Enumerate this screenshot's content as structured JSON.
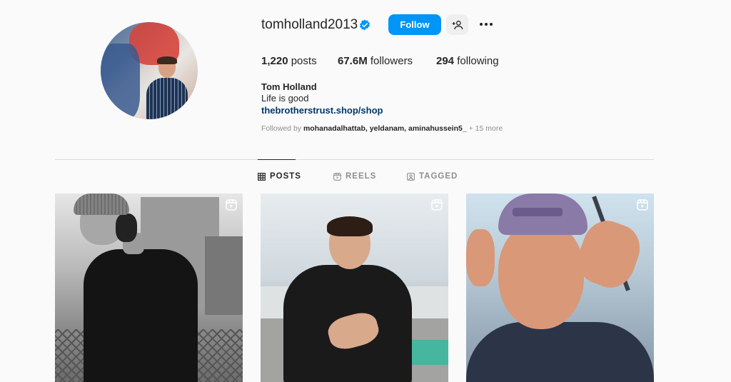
{
  "profile": {
    "username": "tomholland2013",
    "follow_label": "Follow",
    "posts_count": "1,220",
    "posts_label": "posts",
    "followers_count": "67.6M",
    "followers_label": "followers",
    "following_count": "294",
    "following_label": "following",
    "full_name": "Tom Holland",
    "bio": "Life is good",
    "link": "thebrotherstrust.shop/shop",
    "followed_by_prefix": "Followed by",
    "followed_by_names": "mohanadalhattab, yeldanam, aminahussein5_",
    "followed_by_more": "+ 15 more"
  },
  "tabs": [
    {
      "label": "POSTS",
      "icon": "grid-icon",
      "active": true
    },
    {
      "label": "REELS",
      "icon": "reels-icon",
      "active": false
    },
    {
      "label": "TAGGED",
      "icon": "tagged-icon",
      "active": false
    }
  ],
  "posts": [
    {
      "type": "reel",
      "icon": "reel-icon"
    },
    {
      "type": "reel",
      "icon": "reel-icon"
    },
    {
      "type": "reel",
      "icon": "reel-icon"
    }
  ],
  "colors": {
    "accent": "#0095f6",
    "link": "#00376b",
    "background": "#fafafa"
  }
}
